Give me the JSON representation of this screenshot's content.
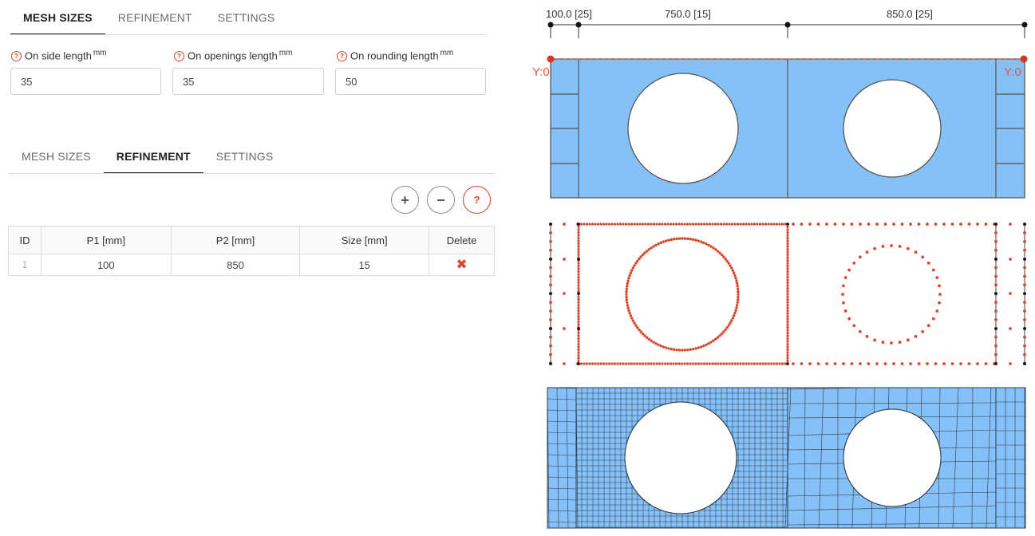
{
  "tabs_top": [
    "MESH SIZES",
    "REFINEMENT",
    "SETTINGS"
  ],
  "tabs_bottom": [
    "MESH SIZES",
    "REFINEMENT",
    "SETTINGS"
  ],
  "fields": {
    "side": {
      "label": "On side length",
      "unit": "mm",
      "value": "35"
    },
    "openings": {
      "label": "On openings length",
      "unit": "mm",
      "value": "35"
    },
    "rounding": {
      "label": "On rounding length",
      "unit": "mm",
      "value": "50"
    }
  },
  "buttons": {
    "add": "+",
    "remove": "−",
    "help": "?"
  },
  "table": {
    "headers": [
      "ID",
      "P1 [mm]",
      "P2 [mm]",
      "Size [mm]",
      "Delete"
    ],
    "rows": [
      {
        "id": "1",
        "p1": "100",
        "p2": "850",
        "size": "15",
        "delete": "✖"
      }
    ]
  },
  "drawing": {
    "dimensions": [
      "100.0 [25]",
      "750.0 [15]",
      "850.0 [25]"
    ],
    "y_labels": [
      "Y:0",
      "Y:0"
    ],
    "colors": {
      "fill": "#85c1f7",
      "edge": "#555555",
      "node_red": "#d9472b",
      "node_black": "#111111",
      "mesh_line": "#2d3a4a"
    }
  }
}
